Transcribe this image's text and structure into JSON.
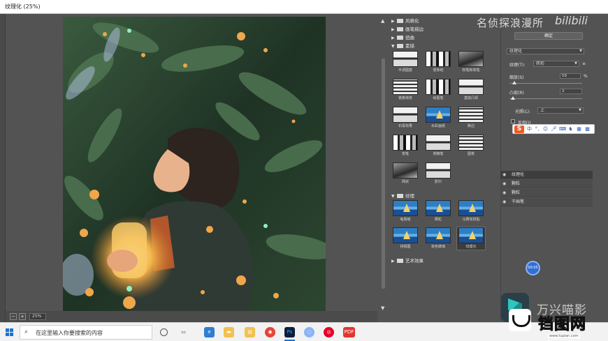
{
  "window": {
    "title": "纹理化 (25%)"
  },
  "zoom": {
    "minus": "−",
    "plus": "+",
    "value": "25%"
  },
  "gallery": {
    "folders": [
      {
        "label": "风格化",
        "open": false
      },
      {
        "label": "画笔描边",
        "open": false
      },
      {
        "label": "扭曲",
        "open": false
      },
      {
        "label": "素描",
        "open": true
      },
      {
        "label": "纹理",
        "open": true
      },
      {
        "label": "艺术效果",
        "open": false
      }
    ],
    "sketch_filters": [
      "半调图案",
      "便条纸",
      "粉笔和炭笔",
      "铬黄渐变",
      "绘图笔",
      "基底凸现",
      "石膏效果",
      "水彩画纸",
      "撕边",
      "炭笔",
      "炭精笔",
      "图章",
      "网状",
      "影印"
    ],
    "texture_filters": [
      "龟裂缝",
      "颗粒",
      "马赛克拼贴",
      "拼缀图",
      "染色玻璃",
      "纹理化"
    ],
    "selected": "纹理化"
  },
  "settings": {
    "ok_label": "确定",
    "filter_select": "纹理化",
    "texture_label": "纹理(T):",
    "texture_value": "砖形",
    "scaling_label": "缩放(S)",
    "scaling_value": "59",
    "scaling_unit": "%",
    "relief_label": "凸现(R)",
    "relief_value": "2",
    "light_label": "光照(L):",
    "light_value": "上",
    "invert_label": "反相(I)"
  },
  "layers": [
    "纹理化",
    "颗粒",
    "颗粒",
    "干画笔"
  ],
  "bubble_label": "00:05",
  "watermarks": {
    "top": "名侦探浪漫所",
    "bili": "bilibili",
    "wanxing": "万兴喵影",
    "tupian": "铛图网",
    "tupian_url": "www.tupian.com"
  },
  "taskbar": {
    "search_placeholder": "在这里输入你要搜索的内容",
    "apps": [
      "cortana-icon",
      "task-view-icon",
      "file-explorer-icon",
      "edge-icon",
      "file-folder-icon",
      "chrome-icon",
      "photoshop-icon",
      "app-icon",
      "netease-music-icon",
      "pdf-icon"
    ]
  }
}
